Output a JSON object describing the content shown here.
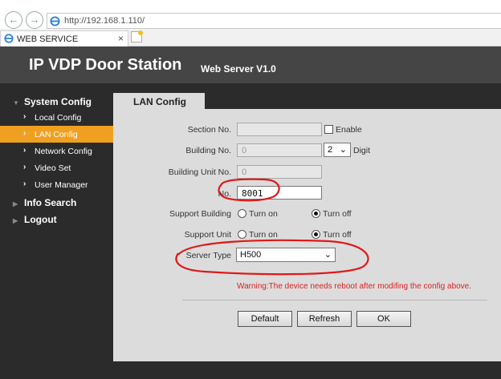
{
  "browser": {
    "url": "http://192.168.1.110/",
    "tab_title": "WEB SERVICE",
    "tab_close": "×"
  },
  "header": {
    "title": "IP VDP Door Station",
    "subtitle": "Web Server V1.0"
  },
  "sidebar": {
    "sections": [
      {
        "label": "System Config"
      },
      {
        "label": "Info Search"
      },
      {
        "label": "Logout"
      }
    ],
    "items": [
      {
        "label": "Local Config",
        "active": false
      },
      {
        "label": "LAN Config",
        "active": true
      },
      {
        "label": "Network Config",
        "active": false
      },
      {
        "label": "Video Set",
        "active": false
      },
      {
        "label": "User Manager",
        "active": false
      }
    ]
  },
  "panel": {
    "tab_label": "LAN Config",
    "section_no": {
      "label": "Section No.",
      "value": "",
      "enable_label": "Enable",
      "enabled": false
    },
    "building_no": {
      "label": "Building No.",
      "value": "0",
      "digit_value": "2",
      "digit_label": "Digit"
    },
    "building_unit_no": {
      "label": "Building Unit No.",
      "value": "0"
    },
    "no": {
      "label": "No.",
      "value": "8001"
    },
    "support_building": {
      "label": "Support Building",
      "on_label": "Turn on",
      "off_label": "Turn off",
      "selected": "off"
    },
    "support_unit": {
      "label": "Support Unit",
      "on_label": "Turn on",
      "off_label": "Turn off",
      "selected": "off"
    },
    "server_type": {
      "label": "Server Type",
      "value": "H500"
    },
    "warning": "Warning:The device needs reboot after modifing the config above.",
    "buttons": {
      "default": "Default",
      "refresh": "Refresh",
      "ok": "OK"
    }
  },
  "colors": {
    "header_bg": "#454545",
    "sidebar_bg": "#2b2b2b",
    "active_item": "#f0a020",
    "panel_bg": "#dcdcdc",
    "warning": "#e02020",
    "annotation": "#e01818"
  }
}
